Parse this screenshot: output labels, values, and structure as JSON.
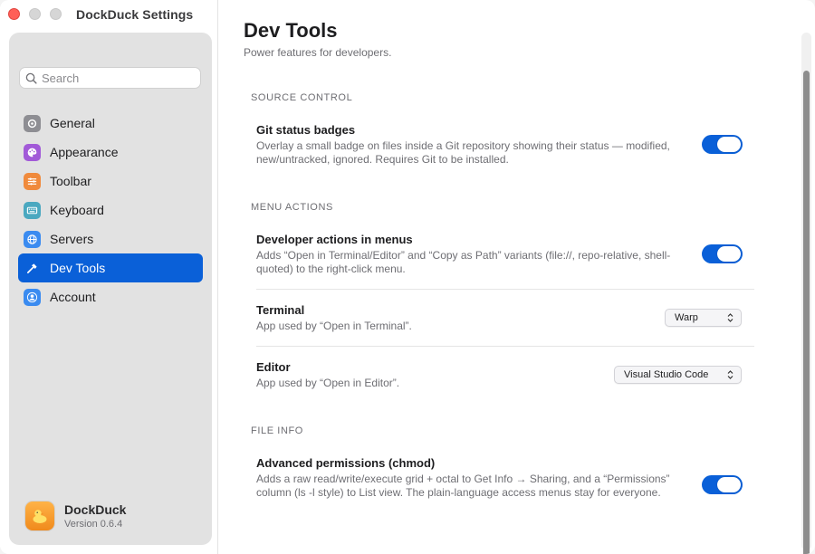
{
  "window": {
    "title": "DockDuck Settings"
  },
  "search": {
    "placeholder": "Search"
  },
  "sidebar": {
    "items": [
      {
        "label": "General",
        "icon": "gear-icon",
        "color": "#8e8e93"
      },
      {
        "label": "Appearance",
        "icon": "palette-icon",
        "color": "#a25ad8"
      },
      {
        "label": "Toolbar",
        "icon": "sliders-icon",
        "color": "#f08a3c"
      },
      {
        "label": "Keyboard",
        "icon": "keyboard-icon",
        "color": "#4aa8c0"
      },
      {
        "label": "Servers",
        "icon": "globe-icon",
        "color": "#3a8bf0"
      },
      {
        "label": "Dev Tools",
        "icon": "hammer-icon",
        "color": "#0a60d8",
        "active": true
      },
      {
        "label": "Account",
        "icon": "person-icon",
        "color": "#3a8bf0"
      }
    ]
  },
  "app": {
    "name": "DockDuck",
    "version": "Version 0.6.4"
  },
  "page": {
    "title": "Dev Tools",
    "subtitle": "Power features for developers."
  },
  "sections": {
    "source_control": {
      "header": "SOURCE CONTROL",
      "git_badges": {
        "title": "Git status badges",
        "description": "Overlay a small badge on files inside a Git repository showing their status — modified, new/untracked, ignored. Requires Git to be installed.",
        "enabled": true
      }
    },
    "menu_actions": {
      "header": "MENU ACTIONS",
      "dev_actions": {
        "title": "Developer actions in menus",
        "description": "Adds “Open in Terminal/Editor” and “Copy as Path” variants (file://, repo-relative, shell-quoted) to the right-click menu.",
        "enabled": true
      },
      "terminal": {
        "title": "Terminal",
        "description": "App used by “Open in Terminal”.",
        "value": "Warp"
      },
      "editor": {
        "title": "Editor",
        "description": "App used by “Open in Editor”.",
        "value": "Visual Studio Code"
      }
    },
    "file_info": {
      "header": "FILE INFO",
      "chmod": {
        "title": "Advanced permissions (chmod)",
        "description": "Adds a raw read/write/execute grid + octal to Get Info → Sharing, and a “Permissions” column (ls -l style) to List view. The plain-language access menus stay for everyone.",
        "enabled": true
      }
    }
  },
  "colors": {
    "accent": "#0a60d8",
    "close": "#ff5f57"
  }
}
